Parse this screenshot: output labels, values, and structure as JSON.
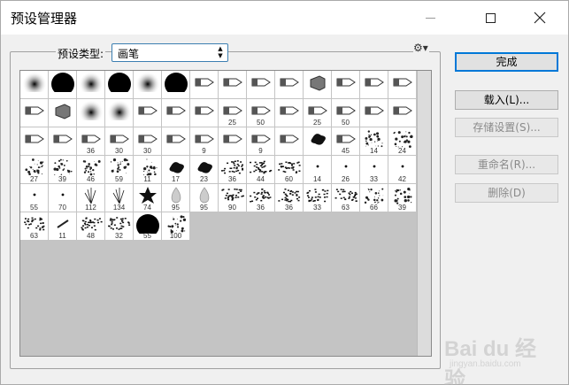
{
  "window": {
    "title": "预设管理器",
    "icons": [
      "minimize-icon",
      "maximize-icon",
      "close-icon"
    ]
  },
  "preset": {
    "type_label": "预设类型:",
    "selected": "画笔"
  },
  "buttons": {
    "done": "完成",
    "load": "载入(L)...",
    "save": "存储设置(S)...",
    "rename": "重命名(R)...",
    "delete": "删除(D)"
  },
  "brushes": [
    {
      "kind": "soft",
      "size": ""
    },
    {
      "kind": "hard",
      "size": ""
    },
    {
      "kind": "soft",
      "size": ""
    },
    {
      "kind": "hard",
      "size": ""
    },
    {
      "kind": "soft",
      "size": ""
    },
    {
      "kind": "hard",
      "size": ""
    },
    {
      "kind": "tip",
      "size": ""
    },
    {
      "kind": "tip",
      "size": ""
    },
    {
      "kind": "tip",
      "size": ""
    },
    {
      "kind": "tip",
      "size": ""
    },
    {
      "kind": "fan",
      "size": ""
    },
    {
      "kind": "tip",
      "size": ""
    },
    {
      "kind": "tip",
      "size": ""
    },
    {
      "kind": "tip",
      "size": ""
    },
    {
      "kind": "tip",
      "size": ""
    },
    {
      "kind": "fan",
      "size": ""
    },
    {
      "kind": "soft",
      "size": ""
    },
    {
      "kind": "soft",
      "size": ""
    },
    {
      "kind": "tip",
      "size": ""
    },
    {
      "kind": "tip",
      "size": ""
    },
    {
      "kind": "tip",
      "size": ""
    },
    {
      "kind": "tip",
      "size": "25"
    },
    {
      "kind": "tip",
      "size": "50"
    },
    {
      "kind": "tip",
      "size": ""
    },
    {
      "kind": "tip",
      "size": "25"
    },
    {
      "kind": "tip",
      "size": "50"
    },
    {
      "kind": "tip",
      "size": ""
    },
    {
      "kind": "tip",
      "size": ""
    },
    {
      "kind": "tip",
      "size": ""
    },
    {
      "kind": "tip",
      "size": ""
    },
    {
      "kind": "tip",
      "size": "36"
    },
    {
      "kind": "tip",
      "size": "30"
    },
    {
      "kind": "tip",
      "size": "30"
    },
    {
      "kind": "tip",
      "size": ""
    },
    {
      "kind": "tip",
      "size": "9"
    },
    {
      "kind": "tip",
      "size": ""
    },
    {
      "kind": "tip",
      "size": "9"
    },
    {
      "kind": "tip",
      "size": ""
    },
    {
      "kind": "splat",
      "size": ""
    },
    {
      "kind": "tip",
      "size": "45"
    },
    {
      "kind": "spatter",
      "size": "14"
    },
    {
      "kind": "spatter",
      "size": "24"
    },
    {
      "kind": "spatter",
      "size": "27"
    },
    {
      "kind": "spatter",
      "size": "39"
    },
    {
      "kind": "spatter",
      "size": "46"
    },
    {
      "kind": "spatter",
      "size": "59"
    },
    {
      "kind": "spatter",
      "size": "11"
    },
    {
      "kind": "splat",
      "size": "17"
    },
    {
      "kind": "splat",
      "size": "23"
    },
    {
      "kind": "texture",
      "size": "36"
    },
    {
      "kind": "texture",
      "size": "44"
    },
    {
      "kind": "texture",
      "size": "60"
    },
    {
      "kind": "dot",
      "size": "14"
    },
    {
      "kind": "dot",
      "size": "26"
    },
    {
      "kind": "dot",
      "size": "33"
    },
    {
      "kind": "dot",
      "size": "42"
    },
    {
      "kind": "dot",
      "size": "55"
    },
    {
      "kind": "dot",
      "size": "70"
    },
    {
      "kind": "grass",
      "size": "112"
    },
    {
      "kind": "grass",
      "size": "134"
    },
    {
      "kind": "leaf",
      "size": "74"
    },
    {
      "kind": "drop",
      "size": "95"
    },
    {
      "kind": "drop",
      "size": "95"
    },
    {
      "kind": "texture",
      "size": "90"
    },
    {
      "kind": "texture",
      "size": "36"
    },
    {
      "kind": "texture",
      "size": "36"
    },
    {
      "kind": "texture",
      "size": "33"
    },
    {
      "kind": "texture",
      "size": "63"
    },
    {
      "kind": "spatter",
      "size": "66"
    },
    {
      "kind": "spatter",
      "size": "39"
    },
    {
      "kind": "texture",
      "size": "63"
    },
    {
      "kind": "stroke",
      "size": "11"
    },
    {
      "kind": "texture",
      "size": "48"
    },
    {
      "kind": "texture",
      "size": "32"
    },
    {
      "kind": "hard",
      "size": "55"
    },
    {
      "kind": "spatter",
      "size": "100"
    }
  ],
  "watermark": {
    "main": "Bai du 经验",
    "sub": "jingyan.baidu.com"
  }
}
